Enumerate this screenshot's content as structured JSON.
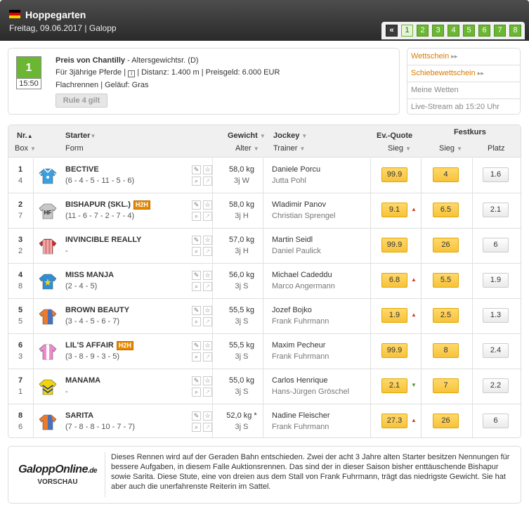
{
  "header": {
    "venue": "Hoppegarten",
    "date_line": "Freitag, 09.06.2017  |  Galopp",
    "flag_colors": [
      "#000000",
      "#dd0000",
      "#ffce00"
    ]
  },
  "race_nav": {
    "back_label": "«",
    "races": [
      "1",
      "2",
      "3",
      "4",
      "5",
      "6",
      "7",
      "8"
    ],
    "active_race": "1"
  },
  "race": {
    "number": "1",
    "time": "15:50",
    "title": "Preis von Chantilly",
    "subtitle": " - Altersgewichtsr. (D)",
    "line2": "Für 3jährige Pferde  |  ",
    "info_icon": "i",
    "line2b": "  |  Distanz: 1.400 m  |  Preisgeld: 6.000 EUR",
    "line3": "Flachrennen  |  Geläuf: Gras",
    "rule_button": "Rule 4 gilt"
  },
  "links": {
    "wettschein": "Wettschein",
    "schiebewettschein": "Schiebewettschein",
    "arrows": "▸▸",
    "meine_wetten": "Meine Wetten",
    "livestream": "Live-Stream ab 15:20 Uhr"
  },
  "table_header": {
    "nr": "Nr.",
    "box": "Box",
    "starter": "Starter",
    "form": "Form",
    "gewicht": "Gewicht",
    "alter": "Alter",
    "jockey": "Jockey",
    "trainer": "Trainer",
    "evquote": "Ev.-Quote",
    "sieg": "Sieg",
    "festkurs": "Festkurs",
    "fk_sieg": "Sieg",
    "platz": "Platz",
    "sort_up": "▲",
    "sort_down": "▼"
  },
  "runners": [
    {
      "nr": "1",
      "box": "4",
      "name": "BECTIVE",
      "form": "(6 - 4 - 5 - 11 - 5 - 6)",
      "h2h": "",
      "weight": "58,0 kg",
      "age": "3j W",
      "jockey": "Daniele Porcu",
      "trainer": "Jutta Pohl",
      "ev": "99.9",
      "trend": "",
      "fk": "4",
      "platz": "1.6",
      "silk": "light-blue-stars",
      "silk_colors": [
        "#3aa0e0",
        "#ffffff"
      ]
    },
    {
      "nr": "2",
      "box": "7",
      "name": "BISHAPUR (SKL.)",
      "form": "(11 - 6 - 7 - 2 - 7 - 4)",
      "h2h": "H2H",
      "weight": "58,0 kg",
      "age": "3j H",
      "jockey": "Wladimir Panov",
      "trainer": "Christian Sprengel",
      "ev": "9.1",
      "trend": "up",
      "fk": "6.5",
      "platz": "2.1",
      "silk": "grey-hf",
      "silk_colors": [
        "#c8c8c8",
        "#222222"
      ]
    },
    {
      "nr": "3",
      "box": "2",
      "name": "INVINCIBLE REALLY",
      "form": "-",
      "h2h": "",
      "weight": "57,0 kg",
      "age": "3j H",
      "jockey": "Martin Seidl",
      "trainer": "Daniel Paulick",
      "ev": "99.9",
      "trend": "",
      "fk": "26",
      "platz": "6",
      "silk": "red-white-stripes",
      "silk_colors": [
        "#cc2b2b",
        "#ffffff"
      ]
    },
    {
      "nr": "4",
      "box": "8",
      "name": "MISS MANJA",
      "form": "(2 - 4 - 5)",
      "h2h": "",
      "weight": "56,0 kg",
      "age": "3j S",
      "jockey": "Michael Cadeddu",
      "trainer": "Marco Angermann",
      "ev": "6.8",
      "trend": "up",
      "fk": "5.5",
      "platz": "1.9",
      "silk": "blue-yellow-star",
      "silk_colors": [
        "#2d8fd8",
        "#f0d020"
      ]
    },
    {
      "nr": "5",
      "box": "5",
      "name": "BROWN BEAUTY",
      "form": "(3 - 4 - 5 - 6 - 7)",
      "h2h": "",
      "weight": "55,5 kg",
      "age": "3j S",
      "jockey": "Jozef Bojko",
      "trainer": "Frank Fuhrmann",
      "ev": "1.9",
      "trend": "up",
      "fk": "2.5",
      "platz": "1.3",
      "silk": "orange-blue",
      "silk_colors": [
        "#ee7a2a",
        "#3a6fc8"
      ]
    },
    {
      "nr": "6",
      "box": "3",
      "name": "LIL'S AFFAIR",
      "form": "(3 - 8 - 9 - 3 - 5)",
      "h2h": "H2H",
      "weight": "55,5 kg",
      "age": "3j S",
      "jockey": "Maxim Pecheur",
      "trainer": "Frank Fuhrmann",
      "ev": "99.9",
      "trend": "",
      "fk": "8",
      "platz": "2.4",
      "silk": "pink-white",
      "silk_colors": [
        "#f08ad0",
        "#ffffff"
      ]
    },
    {
      "nr": "7",
      "box": "1",
      "name": "MANAMA",
      "form": "-",
      "h2h": "",
      "weight": "55,0 kg",
      "age": "3j S",
      "jockey": "Carlos Henrique",
      "trainer": "Hans-Jürgen Gröschel",
      "ev": "2.1",
      "trend": "down",
      "fk": "7",
      "platz": "2.2",
      "silk": "yellow-blue-chevrons",
      "silk_colors": [
        "#f2d40c",
        "#1c3b90"
      ]
    },
    {
      "nr": "8",
      "box": "6",
      "name": "SARITA",
      "form": "(7 - 8 - 8 - 10 - 7 - 7)",
      "h2h": "",
      "weight": "52,0 kg  *",
      "age": "3j S",
      "jockey": "Nadine Fleischer",
      "trainer": "Frank Fuhrmann",
      "ev": "27.3",
      "trend": "up",
      "fk": "26",
      "platz": "6",
      "silk": "orange-blue",
      "silk_colors": [
        "#ee7a2a",
        "#3a6fc8"
      ]
    }
  ],
  "row_icons": {
    "pencil": "✎",
    "star": "☆",
    "search": "⌕",
    "chart": "↗"
  },
  "trend_symbols": {
    "up": "▲",
    "down": "▼"
  },
  "preview": {
    "logo_main": "GaloppOnline",
    "logo_tld": ".de",
    "logo_sub": "VORSCHAU",
    "text": "Dieses Rennen wird auf der Geraden Bahn entschieden. Zwei der acht 3 Jahre alten Starter besitzen Nennungen für bessere Aufgaben, in diesem Falle Auktionsrennen. Das sind der in dieser Saison bisher enttäuschende Bishapur sowie Sarita. Diese Stute, eine von dreien aus dem Stall von Frank Fuhrmann, trägt das niedrigste Gewicht. Sie hat aber auch die unerfahrenste Reiterin im Sattel."
  },
  "colors": {
    "accent_green": "#6bb632",
    "odds_yellow": "#f7c23a",
    "link_orange": "#d97a00"
  }
}
